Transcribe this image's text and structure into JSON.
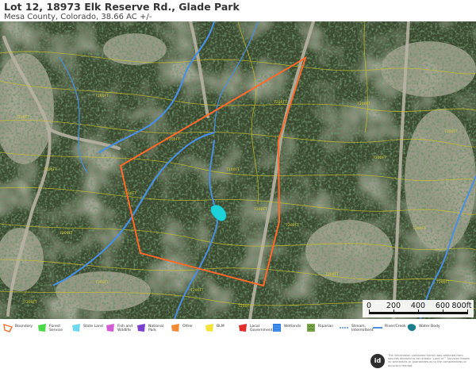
{
  "header": {
    "title": "Lot 12, 18973 Elk Reserve Rd., Glade Park",
    "subtitle": "Mesa County, Colorado, 38.66 AC +/-"
  },
  "scale": {
    "labels": [
      "0",
      "200",
      "400",
      "600",
      "800ft"
    ],
    "values_ft": [
      0,
      200,
      400,
      600,
      800
    ]
  },
  "map": {
    "boundary_color": "#ff6a2b",
    "stream_color": "#4a8fe0",
    "water_color": "#1ed3d8",
    "contour_color": "#c9c22c",
    "contour_label": "7200FT"
  },
  "legend": [
    {
      "label": "Boundary",
      "color": "#ff6a2b",
      "icon": "boundary-icon"
    },
    {
      "label": "Forest Service",
      "color": "#49d949",
      "icon": "forest-service-icon"
    },
    {
      "label": "State Land",
      "color": "#6fd8ee",
      "icon": "state-land-icon"
    },
    {
      "label": "Fish and Wildlife",
      "color": "#d25bd6",
      "icon": "fish-wildlife-icon"
    },
    {
      "label": "National Park",
      "color": "#7a3fcf",
      "icon": "national-park-icon"
    },
    {
      "label": "Other",
      "color": "#f58a33",
      "icon": "other-icon"
    },
    {
      "label": "BLM",
      "color": "#f4e23a",
      "icon": "blm-icon"
    },
    {
      "label": "Local Government",
      "color": "#e0302b",
      "icon": "local-government-icon"
    },
    {
      "label": "Wetlands",
      "color": "#2f7fe0",
      "icon": "wetlands-icon"
    },
    {
      "label": "Riparian",
      "color": "#7aa84a",
      "icon": "riparian-icon"
    },
    {
      "label": "Stream, Intermittent",
      "color": "#4a8fe0",
      "icon": "stream-intermittent-icon"
    },
    {
      "label": "River/Creek",
      "color": "#4a8fe0",
      "icon": "river-creek-icon"
    },
    {
      "label": "Water Body",
      "color": "#197d8e",
      "icon": "water-body-icon"
    }
  ],
  "footer": {
    "logo": "id",
    "disclaimer": "The information contained herein was obtained from sources deemed to be reliable. Land id™ Services makes no warranties or guarantees as to the completeness or accuracy thereof."
  }
}
